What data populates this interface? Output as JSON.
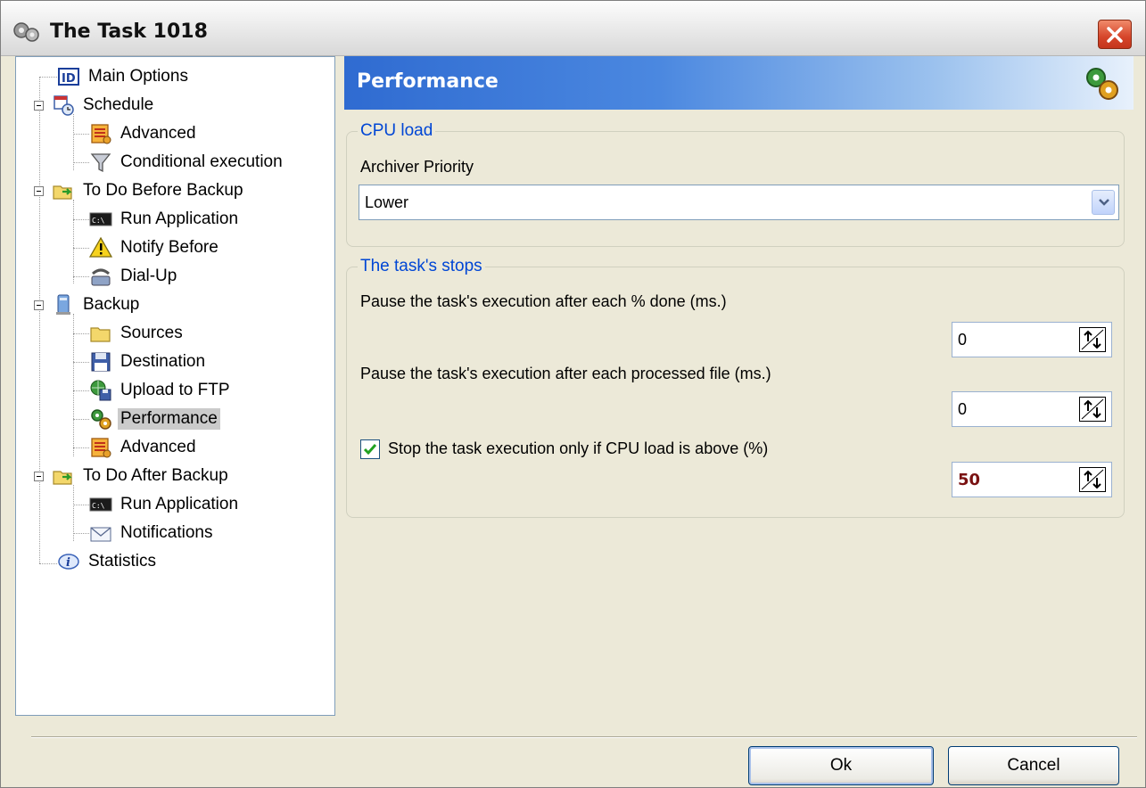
{
  "window": {
    "title": "The Task 1018"
  },
  "tree": {
    "items": [
      {
        "label": "Main Options",
        "icon": "id-card-icon"
      },
      {
        "label": "Schedule",
        "icon": "calendar-clock-icon"
      },
      {
        "label": "Advanced",
        "icon": "settings-list-icon"
      },
      {
        "label": "Conditional execution",
        "icon": "filter-funnel-icon"
      },
      {
        "label": "To Do Before Backup",
        "icon": "folder-arrow-icon"
      },
      {
        "label": "Run Application",
        "icon": "console-icon"
      },
      {
        "label": "Notify Before",
        "icon": "warning-icon"
      },
      {
        "label": "Dial-Up",
        "icon": "phone-modem-icon"
      },
      {
        "label": "Backup",
        "icon": "computer-icon"
      },
      {
        "label": "Sources",
        "icon": "folder-icon"
      },
      {
        "label": "Destination",
        "icon": "floppy-disk-icon"
      },
      {
        "label": "Upload to FTP",
        "icon": "globe-floppy-icon"
      },
      {
        "label": "Performance",
        "icon": "gears-icon"
      },
      {
        "label": "Advanced",
        "icon": "settings-list-icon"
      },
      {
        "label": "To Do After Backup",
        "icon": "folder-arrow-icon"
      },
      {
        "label": "Run Application",
        "icon": "console-icon"
      },
      {
        "label": "Notifications",
        "icon": "envelope-icon"
      },
      {
        "label": "Statistics",
        "icon": "info-icon"
      }
    ],
    "selected": "Performance"
  },
  "panel": {
    "title": "Performance",
    "icon": "gears-icon"
  },
  "cpu_group": {
    "legend": "CPU load",
    "priority_label": "Archiver Priority",
    "priority_value": "Lower"
  },
  "stops_group": {
    "legend": "The task's stops",
    "pause_percent_label": "Pause the task's execution after each % done (ms.)",
    "pause_percent_value": "0",
    "pause_file_label": "Pause the task's execution after each processed file (ms.)",
    "pause_file_value": "0",
    "cpu_check_label": "Stop the task execution only if CPU load is above (%)",
    "cpu_check_checked": true,
    "cpu_threshold_value": "50"
  },
  "footer": {
    "ok_label": "Ok",
    "cancel_label": "Cancel"
  },
  "colors": {
    "accent": "#2f6bd1",
    "legend_text": "#0046d5",
    "threshold_text": "#7a1212",
    "close_button": "#d6452a"
  }
}
